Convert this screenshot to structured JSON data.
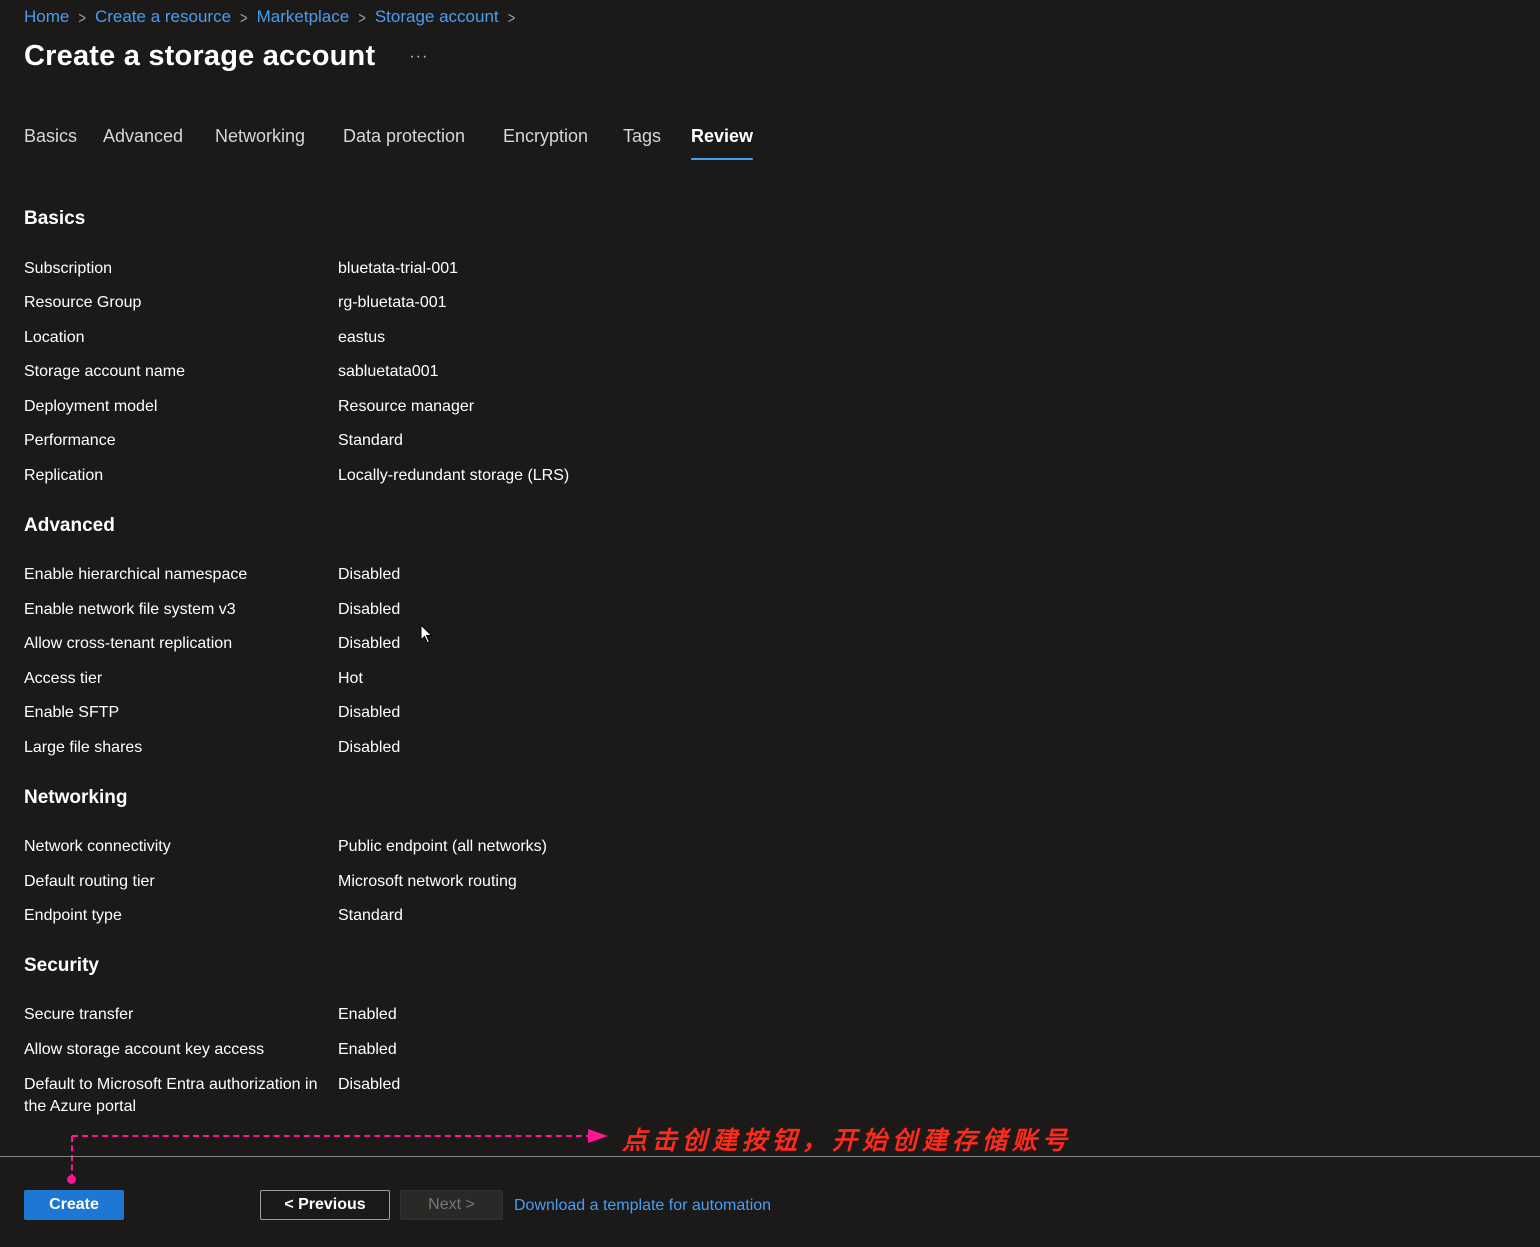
{
  "breadcrumb": {
    "items": [
      "Home",
      "Create a resource",
      "Marketplace",
      "Storage account"
    ]
  },
  "header": {
    "title": "Create a storage account",
    "more_label": "···"
  },
  "tabs": [
    {
      "label": "Basics",
      "active": false
    },
    {
      "label": "Advanced",
      "active": false
    },
    {
      "label": "Networking",
      "active": false
    },
    {
      "label": "Data protection",
      "active": false
    },
    {
      "label": "Encryption",
      "active": false
    },
    {
      "label": "Tags",
      "active": false
    },
    {
      "label": "Review",
      "active": true
    }
  ],
  "sections": {
    "basics": {
      "heading": "Basics",
      "rows": [
        {
          "label": "Subscription",
          "value": "bluetata-trial-001"
        },
        {
          "label": "Resource Group",
          "value": "rg-bluetata-001"
        },
        {
          "label": "Location",
          "value": "eastus"
        },
        {
          "label": "Storage account name",
          "value": "sabluetata001"
        },
        {
          "label": "Deployment model",
          "value": "Resource manager"
        },
        {
          "label": "Performance",
          "value": "Standard"
        },
        {
          "label": "Replication",
          "value": "Locally-redundant storage (LRS)"
        }
      ]
    },
    "advanced": {
      "heading": "Advanced",
      "rows": [
        {
          "label": "Enable hierarchical namespace",
          "value": "Disabled"
        },
        {
          "label": "Enable network file system v3",
          "value": "Disabled"
        },
        {
          "label": "Allow cross-tenant replication",
          "value": "Disabled"
        },
        {
          "label": "Access tier",
          "value": "Hot"
        },
        {
          "label": "Enable SFTP",
          "value": "Disabled"
        },
        {
          "label": "Large file shares",
          "value": "Disabled"
        }
      ]
    },
    "networking": {
      "heading": "Networking",
      "rows": [
        {
          "label": "Network connectivity",
          "value": "Public endpoint (all networks)"
        },
        {
          "label": "Default routing tier",
          "value": "Microsoft network routing"
        },
        {
          "label": "Endpoint type",
          "value": "Standard"
        }
      ]
    },
    "security": {
      "heading": "Security",
      "rows": [
        {
          "label": "Secure transfer",
          "value": "Enabled"
        },
        {
          "label": "Allow storage account key access",
          "value": "Enabled"
        },
        {
          "label": "Default to Microsoft Entra authorization in the Azure portal",
          "value": "Disabled"
        }
      ]
    }
  },
  "annotation": {
    "text": "点击创建按钮，开始创建存储账号",
    "color": "#ff1493"
  },
  "footer": {
    "create_label": "Create",
    "previous_label": "< Previous",
    "next_label": "Next >",
    "download_label": "Download a template for automation"
  },
  "colors": {
    "background": "#1b1a19",
    "link": "#479ef5",
    "primary_button": "#1e78d3"
  }
}
